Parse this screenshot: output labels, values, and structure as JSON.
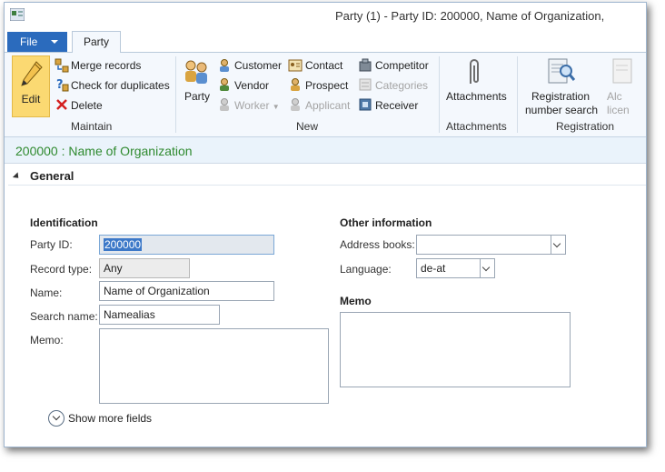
{
  "window": {
    "title": "Party (1) - Party ID: 200000, Name of Organization,"
  },
  "tabs": {
    "file": "File",
    "party": "Party"
  },
  "ribbon": {
    "edit": "Edit",
    "merge_records": "Merge records",
    "check_duplicates": "Check for duplicates",
    "delete": "Delete",
    "maintain_group": "Maintain",
    "party": "Party",
    "customer": "Customer",
    "vendor": "Vendor",
    "worker": "Worker",
    "contact": "Contact",
    "prospect": "Prospect",
    "applicant": "Applicant",
    "competitor": "Competitor",
    "categories": "Categories",
    "receiver": "Receiver",
    "new_group": "New",
    "attachments": "Attachments",
    "attachments_group": "Attachments",
    "registration_line1": "Registration",
    "registration_line2": "number search",
    "registration_group": "Registration",
    "cut_label_line1": "Alc",
    "cut_label_line2": "licen"
  },
  "record": {
    "title": "200000 : Name of Organization"
  },
  "section": {
    "general": "General"
  },
  "identification": {
    "heading": "Identification",
    "party_id_label": "Party ID:",
    "party_id_value": "200000",
    "record_type_label": "Record type:",
    "record_type_value": "Any",
    "name_label": "Name:",
    "name_value": "Name of Organization",
    "search_name_label": "Search name:",
    "search_name_value": "Namealias",
    "memo_label": "Memo:"
  },
  "other": {
    "heading": "Other information",
    "address_books_label": "Address books:",
    "address_books_value": "",
    "language_label": "Language:",
    "language_value": "de-at",
    "memo_heading": "Memo"
  },
  "show_more": "Show more fields",
  "colors": {
    "file_tab": "#2b6bbd",
    "record_title": "#2f8a2f",
    "edit_highlight": "#fbd972"
  }
}
